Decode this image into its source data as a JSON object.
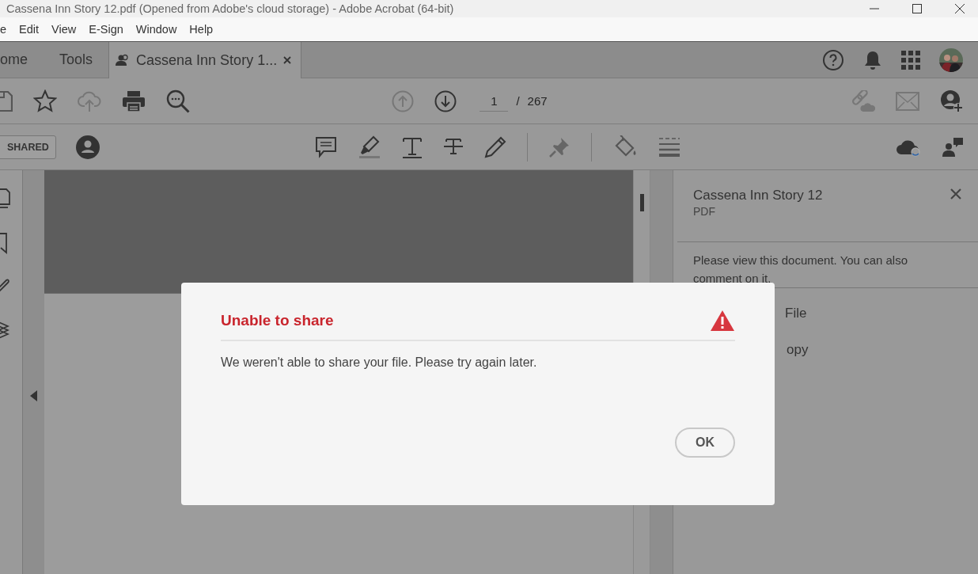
{
  "window": {
    "title": "Cassena Inn Story 12.pdf (Opened from Adobe's cloud storage) - Adobe Acrobat (64-bit)"
  },
  "menu": [
    "e",
    "Edit",
    "View",
    "E-Sign",
    "Window",
    "Help"
  ],
  "tabs": [
    {
      "label": "ome",
      "selected": false,
      "kind": "plain"
    },
    {
      "label": "Tools",
      "selected": false,
      "kind": "plain"
    },
    {
      "label": "Cassena Inn Story 1...",
      "selected": true,
      "kind": "document"
    }
  ],
  "page_nav": {
    "current": "1",
    "separator": "/",
    "total": "267"
  },
  "shared_badge": "SHARED",
  "share_panel": {
    "title": "Cassena Inn Story 12",
    "type": "PDF",
    "message": "Please view this document. You can also comment on it.",
    "options": [
      "File",
      "opy"
    ]
  },
  "dialog": {
    "title": "Unable to share",
    "message": "We weren't able to share your file. Please try again later.",
    "button": "OK"
  }
}
